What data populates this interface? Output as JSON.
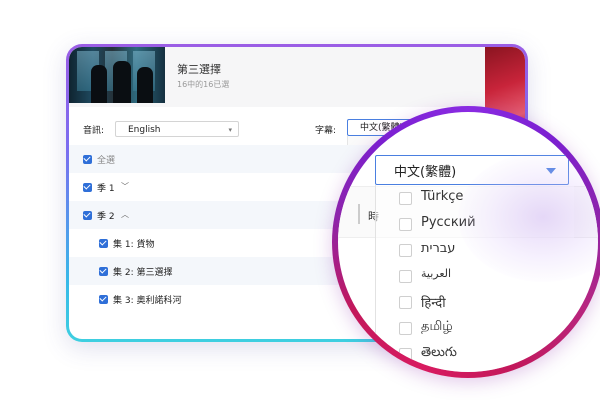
{
  "episode": {
    "title": "第三選擇",
    "subtitle": "16中的16已選"
  },
  "audio": {
    "label": "音訊:",
    "value": "English"
  },
  "subtitles": {
    "label": "字幕:",
    "value": "中文(繁體)"
  },
  "list": [
    {
      "label": "全選",
      "checked": true
    },
    {
      "label": "季 1",
      "checked": true
    },
    {
      "label": "季 2",
      "checked": true
    },
    {
      "label": "集 1: 貨物",
      "checked": true
    },
    {
      "label": "集 2: 第三選擇",
      "checked": true
    },
    {
      "label": "集 3: 奧利諾科河",
      "checked": true
    }
  ],
  "magnifier": {
    "colon": ":",
    "selected": "中文(繁體)",
    "partial_char": "時",
    "options": [
      "Türkçe",
      "Русский",
      "עברית",
      "العربية",
      "हिन्दी",
      "தமிழ்",
      "తెలుగు"
    ]
  },
  "colors": {
    "accent": "#2f6fd8",
    "ring_top": "#8a2be2",
    "ring_bottom": "#d81b60",
    "card_border_top": "#9b5de5",
    "card_border_bottom": "#3ecfe0"
  },
  "icons": {
    "dropdown": "chevron-down-icon",
    "expand": "chevron-up-icon",
    "check": "checkbox-checked-icon"
  }
}
